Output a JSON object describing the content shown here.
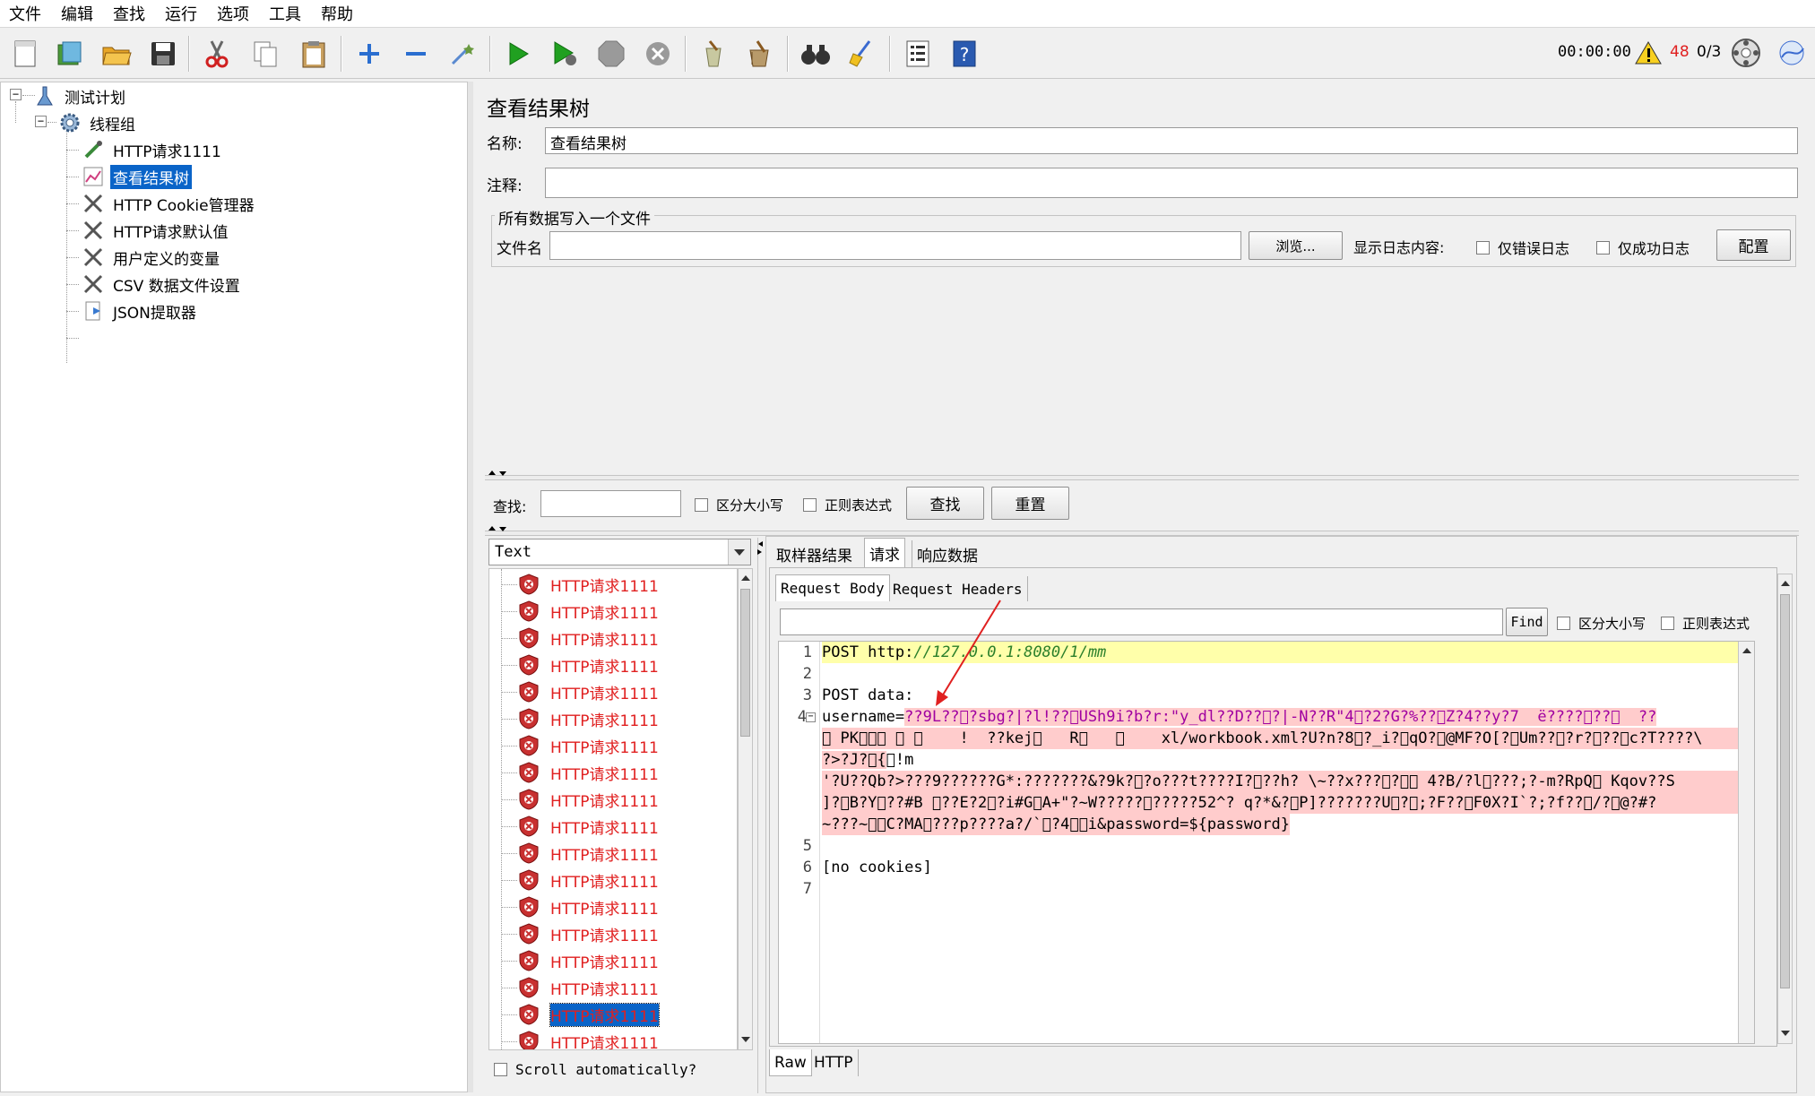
{
  "menu": [
    "文件",
    "编辑",
    "查找",
    "运行",
    "选项",
    "工具",
    "帮助"
  ],
  "status": {
    "timer": "00:00:00",
    "warning_count": "48",
    "threads": "0/3"
  },
  "tree": {
    "items": [
      {
        "label": "测试计划"
      },
      {
        "label": "线程组"
      },
      {
        "label": "HTTP请求1111"
      },
      {
        "label": "查看结果树"
      },
      {
        "label": "HTTP Cookie管理器"
      },
      {
        "label": "HTTP请求默认值"
      },
      {
        "label": "用户定义的变量"
      },
      {
        "label": "CSV 数据文件设置"
      },
      {
        "label": "JSON提取器"
      }
    ]
  },
  "panel": {
    "title": "查看结果树",
    "name_label": "名称:",
    "name_value": "查看结果树",
    "comment_label": "注释:",
    "comment_value": "",
    "file_group_title": "所有数据写入一个文件",
    "filename_label": "文件名",
    "filename_value": "",
    "browse_button": "浏览...",
    "log_content_label": "显示日志内容:",
    "errors_only": "仅错误日志",
    "success_only": "仅成功日志",
    "configure_button": "配置"
  },
  "search": {
    "label": "查找:",
    "value": "",
    "case_sensitive": "区分大小写",
    "regex": "正则表达式",
    "find_button": "查找",
    "reset_button": "重置"
  },
  "results": {
    "renderer": "Text",
    "item_label": "HTTP请求1111",
    "scroll_auto": "Scroll automatically?"
  },
  "tabs": {
    "sampler_result": "取样器结果",
    "request": "请求",
    "response_data": "响应数据",
    "request_body": "Request Body",
    "request_headers": "Request Headers",
    "raw": "Raw",
    "http": "HTTP"
  },
  "request_search": {
    "value": "",
    "find_button": "Find",
    "case_sensitive": "区分大小写",
    "regex": "正则表达式"
  },
  "editor": {
    "line_numbers": [
      "1",
      "2",
      "3",
      "4",
      "5",
      "6",
      "7"
    ],
    "line1_method": "POST http:",
    "line1_url": "//127.0.0.1:8080/1/mm",
    "line3": "POST data:",
    "line4_key": "username=",
    "line4_rest": "??9L??\u0000?sbg?|?l!??\u0000USh9i?b?r:\"y_dl??D??\u0000?|-N??R\"4\u0000?2?G?%??\u0007Z?4??y?7  ë????\u0000??\u0000  ??",
    "wrap1": "\u0000 PK\u0000\u0000\u0000 \u0000 \u0000    !  ??kej\u0000   R\u0000   \u0000    xl/workbook.xml?U?n?8\u0000?_i?\u0000qO?\u0000@MF?O[?\u0000Um??\u0000?r?\u0000??\u0000c?T????\\",
    "wrap2": "?>?J?\u0000{",
    "wrap2_tail": "!m",
    "wrap3": "'?U??Qb?>???9??????G*:???????&?9k?\u0000?o???t????I?\u0000??h? \\~??x???\u0000?\u0000\u0000 4?B/?l\u0000???;?-m?RpQ\u0000 Kqov??S",
    "wrap4": "]?\u0000B?Y\u0000??#B \u0000??E?2\u0000?i#G\u0000A+\"?~W?????\u0000?????52^? q?*&?\u0000P]???????U\u0000?\u0000;?F??\u0000F0X?I`?;?f??\u0000/?\u0000@?#?",
    "wrap5": "~???~\u0000\u0000C?MA\u0000???p????a?/`\u0000?4\u0000\u0000i&password=${password}",
    "line6": "[no cookies]"
  },
  "colors": {
    "selection": "#0a64c8",
    "error_text": "#e02020",
    "highlight_yellow": "#ffffaa",
    "highlight_pink": "#ffcccc"
  }
}
